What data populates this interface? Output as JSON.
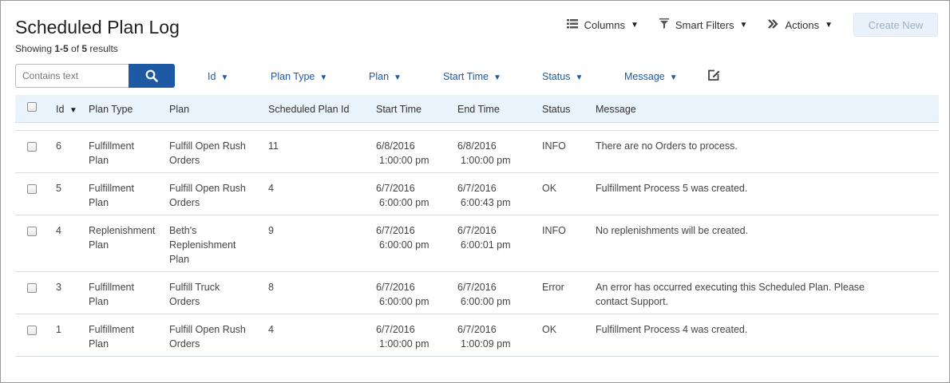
{
  "page": {
    "title": "Scheduled Plan Log",
    "showing_prefix": "Showing ",
    "showing_range": "1-5",
    "showing_of": " of ",
    "showing_total": "5",
    "showing_suffix": " results"
  },
  "toolbar": {
    "columns_label": "Columns",
    "smart_filters_label": "Smart Filters",
    "actions_label": "Actions",
    "create_new_label": "Create New"
  },
  "search": {
    "placeholder": "Contains text"
  },
  "filters": [
    {
      "label": "Id"
    },
    {
      "label": "Plan Type"
    },
    {
      "label": "Plan"
    },
    {
      "label": "Start Time"
    },
    {
      "label": "Status"
    },
    {
      "label": "Message"
    }
  ],
  "table": {
    "headers": {
      "id": "Id",
      "plan_type": "Plan Type",
      "plan": "Plan",
      "scheduled_plan_id": "Scheduled Plan Id",
      "start_time": "Start Time",
      "end_time": "End Time",
      "status": "Status",
      "message": "Message"
    },
    "rows": [
      {
        "id": "6",
        "plan_type": [
          "Fulfillment",
          "Plan"
        ],
        "plan": [
          "Fulfill Open Rush",
          "Orders"
        ],
        "scheduled_plan_id": "11",
        "start_date": "6/8/2016",
        "start_time": "1:00:00 pm",
        "end_date": "6/8/2016",
        "end_time": "1:00:00 pm",
        "status": "INFO",
        "message": "There are no Orders to process."
      },
      {
        "id": "5",
        "plan_type": [
          "Fulfillment",
          "Plan"
        ],
        "plan": [
          "Fulfill Open Rush",
          "Orders"
        ],
        "scheduled_plan_id": "4",
        "start_date": "6/7/2016",
        "start_time": "6:00:00 pm",
        "end_date": "6/7/2016",
        "end_time": "6:00:43 pm",
        "status": "OK",
        "message": "Fulfillment Process 5 was created."
      },
      {
        "id": "4",
        "plan_type": [
          "Replenishment",
          "Plan"
        ],
        "plan": [
          "Beth's",
          "Replenishment",
          "Plan"
        ],
        "scheduled_plan_id": "9",
        "start_date": "6/7/2016",
        "start_time": "6:00:00 pm",
        "end_date": "6/7/2016",
        "end_time": "6:00:01 pm",
        "status": "INFO",
        "message": "No replenishments will be created."
      },
      {
        "id": "3",
        "plan_type": [
          "Fulfillment",
          "Plan"
        ],
        "plan": [
          "Fulfill Truck",
          "Orders"
        ],
        "scheduled_plan_id": "8",
        "start_date": "6/7/2016",
        "start_time": "6:00:00 pm",
        "end_date": "6/7/2016",
        "end_time": "6:00:00 pm",
        "status": "Error",
        "message": "An error has occurred executing this Scheduled Plan. Please contact Support."
      },
      {
        "id": "1",
        "plan_type": [
          "Fulfillment",
          "Plan"
        ],
        "plan": [
          "Fulfill Open Rush",
          "Orders"
        ],
        "scheduled_plan_id": "4",
        "start_date": "6/7/2016",
        "start_time": "1:00:00 pm",
        "end_date": "6/7/2016",
        "end_time": "1:00:09 pm",
        "status": "OK",
        "message": "Fulfillment Process 4 was created."
      }
    ]
  },
  "colors": {
    "accent": "#1d5aa3",
    "header_bg": "#e9f3fc",
    "disabled_bg": "#e9f2fa"
  },
  "icons": {
    "columns": "list-icon",
    "smart_filters": "funnel-icon",
    "actions": "double-chevron-icon",
    "search": "search-icon",
    "edit": "edit-icon",
    "sort": "caret-down-icon"
  }
}
